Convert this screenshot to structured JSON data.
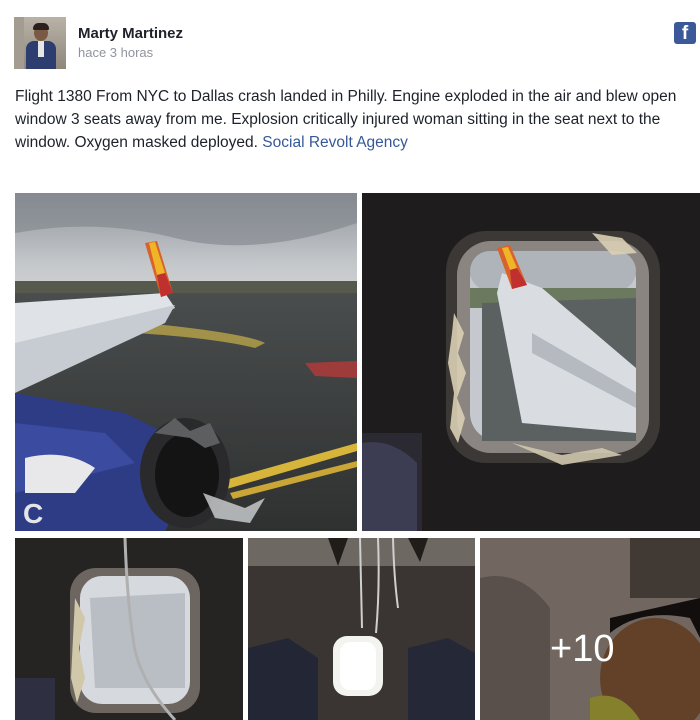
{
  "post": {
    "author": "Marty Martinez",
    "timestamp": "hace 3 horas",
    "text": "Flight 1380 From NYC to Dallas crash landed in Philly. Engine exploded in the air and blew open window 3 seats away from me. Explosion critically injured woman sitting in the seat next to the window. Oxygen masked deployed.",
    "link_text": "Social Revolt Agency",
    "more_photos_label": "+10",
    "platform_icon": "facebook-icon",
    "platform_glyph": "f"
  },
  "colors": {
    "link": "#365899",
    "facebook_blue": "#3b5998",
    "timestamp": "#90949c"
  }
}
